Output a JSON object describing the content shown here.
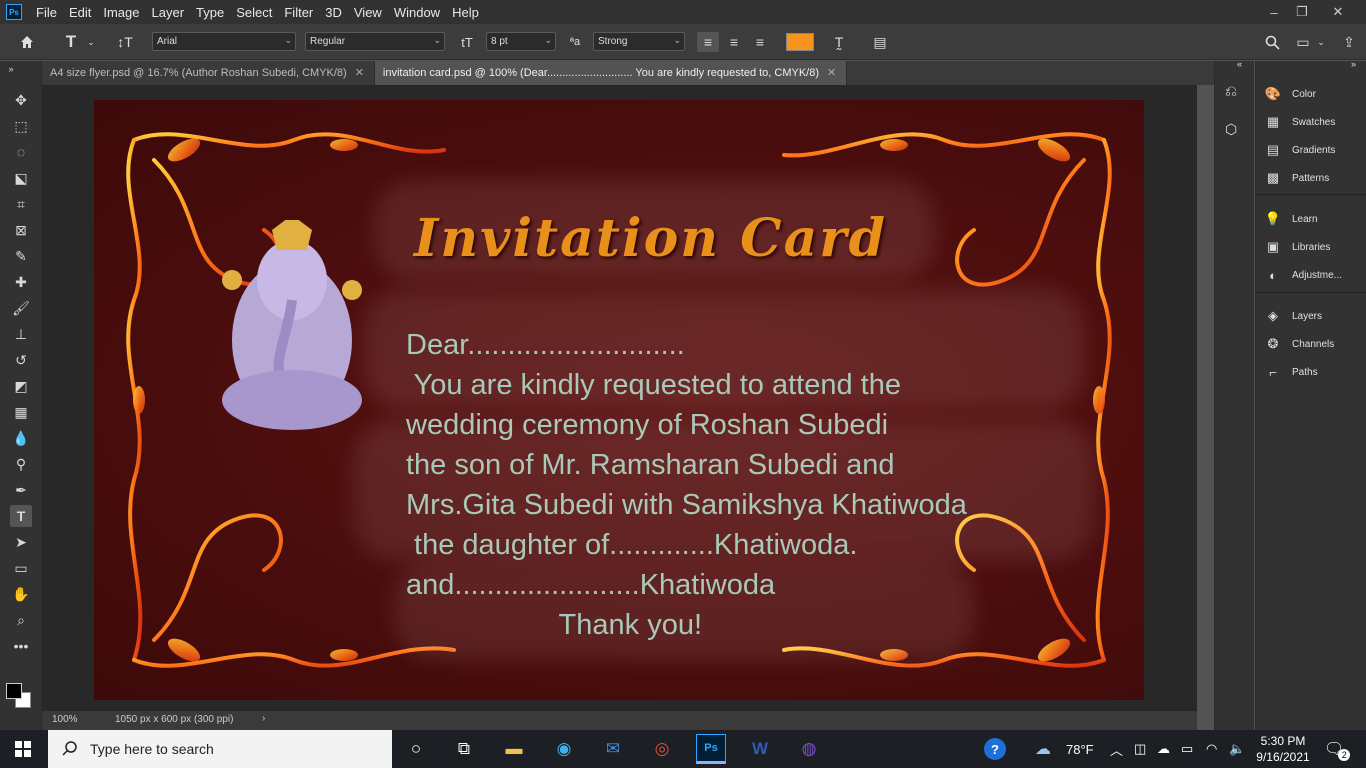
{
  "menubar": {
    "logo": "Ps",
    "items": [
      "File",
      "Edit",
      "Image",
      "Layer",
      "Type",
      "Select",
      "Filter",
      "3D",
      "View",
      "Window",
      "Help"
    ]
  },
  "options": {
    "font_family": "Arial",
    "font_style": "Regular",
    "font_size": "8 pt",
    "aa_label": "ªa",
    "antialias": "Strong",
    "text_color": "#f7941d"
  },
  "tabs": [
    {
      "label": "A4 size flyer.psd @ 16.7% (Author Roshan Subedi, CMYK/8)",
      "active": false
    },
    {
      "label": "invitation card.psd @ 100% (Dear............................   You are kindly requested to, CMYK/8)",
      "active": true
    }
  ],
  "document": {
    "title": "Invitation Card",
    "lines": [
      "Dear...........................",
      " You are kindly requested to attend the",
      "wedding ceremony of Roshan Subedi",
      "the son of Mr. Ramsharan Subedi and",
      "Mrs.Gita Subedi with Samikshya Khatiwoda",
      " the daughter of.............Khatiwoda.",
      "and.......................Khatiwoda",
      "                   Thank you!"
    ]
  },
  "status": {
    "zoom": "100%",
    "doc_info": "1050 px x 600 px (300 ppi)"
  },
  "panels": {
    "group1": [
      "Color",
      "Swatches",
      "Gradients",
      "Patterns"
    ],
    "group2": [
      "Learn",
      "Libraries",
      "Adjustme..."
    ],
    "group3": [
      "Layers",
      "Channels",
      "Paths"
    ]
  },
  "taskbar": {
    "search_placeholder": "Type here to search",
    "weather": "78°F",
    "time": "5:30 PM",
    "date": "9/16/2021",
    "notification_count": "2"
  }
}
